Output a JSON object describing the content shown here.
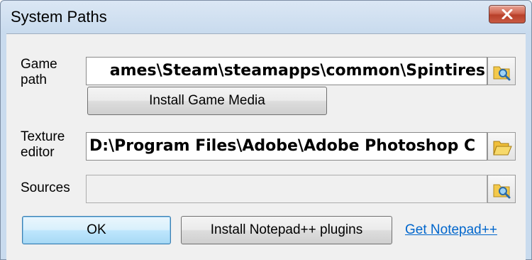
{
  "window": {
    "title": "System Paths"
  },
  "fields": {
    "game_path": {
      "label": "Game path",
      "value": "ames\\Steam\\steamapps\\common\\Spintires"
    },
    "texture_editor": {
      "label": "Texture editor",
      "value": "D:\\Program Files\\Adobe\\Adobe Photoshop C"
    },
    "sources": {
      "label": "Sources",
      "value": ""
    }
  },
  "buttons": {
    "install_game_media": "Install Game Media",
    "ok": "OK",
    "install_notepad_plugins": "Install Notepad++ plugins"
  },
  "links": {
    "get_notepad": "Get Notepad++"
  },
  "icons": {
    "close": "close-icon",
    "browse_game": "search-folder-icon",
    "browse_texture": "open-folder-icon",
    "browse_sources": "search-folder-icon"
  },
  "colors": {
    "link": "#0066cc",
    "close_button": "#c85a44",
    "window_frame": "#c9dbee",
    "default_button": "#bee6fd"
  }
}
